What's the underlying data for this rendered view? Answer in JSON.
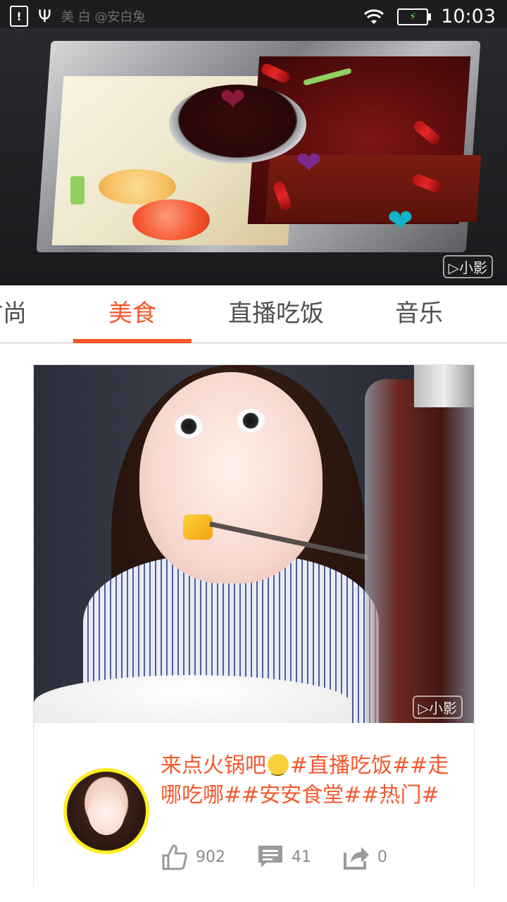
{
  "status_bar": {
    "notification_glyph": "!",
    "watermark_text": "美 白 @安白兔",
    "time": "10:03"
  },
  "banner": {
    "hearts": [
      {
        "color": "#8a1838"
      },
      {
        "color": "#7a2a8c"
      },
      {
        "color": "#12b3c8"
      }
    ],
    "badge_label": "▷小影"
  },
  "tabs": [
    {
      "label": "时尚"
    },
    {
      "label": "美食",
      "active": true
    },
    {
      "label": "直播吃饭"
    },
    {
      "label": "音乐"
    }
  ],
  "card": {
    "photo_badge_label": "▷小影",
    "caption_before_emoji": "来点火锅吧",
    "caption_after_emoji": "#直播吃饭##走哪吃哪##安安食堂##热门#",
    "likes": "902",
    "comments": "41",
    "shares": "0"
  },
  "colors": {
    "accent": "#f5592c",
    "avatar_ring": "#ffee1f",
    "icon_gray": "#9a9a9a"
  }
}
